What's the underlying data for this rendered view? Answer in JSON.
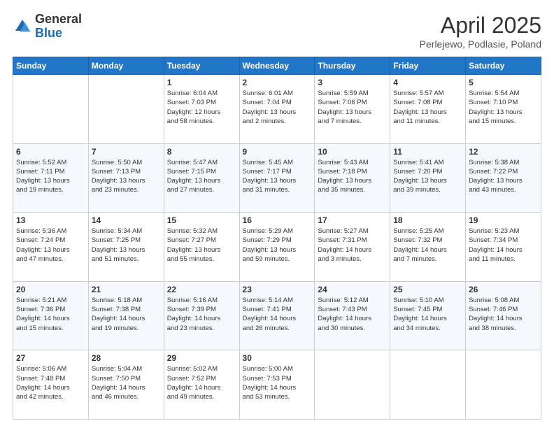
{
  "header": {
    "logo_general": "General",
    "logo_blue": "Blue",
    "month_title": "April 2025",
    "subtitle": "Perlejewo, Podlasie, Poland"
  },
  "days_of_week": [
    "Sunday",
    "Monday",
    "Tuesday",
    "Wednesday",
    "Thursday",
    "Friday",
    "Saturday"
  ],
  "weeks": [
    [
      {
        "day": "",
        "info": ""
      },
      {
        "day": "",
        "info": ""
      },
      {
        "day": "1",
        "info": "Sunrise: 6:04 AM\nSunset: 7:03 PM\nDaylight: 12 hours\nand 58 minutes."
      },
      {
        "day": "2",
        "info": "Sunrise: 6:01 AM\nSunset: 7:04 PM\nDaylight: 13 hours\nand 2 minutes."
      },
      {
        "day": "3",
        "info": "Sunrise: 5:59 AM\nSunset: 7:06 PM\nDaylight: 13 hours\nand 7 minutes."
      },
      {
        "day": "4",
        "info": "Sunrise: 5:57 AM\nSunset: 7:08 PM\nDaylight: 13 hours\nand 11 minutes."
      },
      {
        "day": "5",
        "info": "Sunrise: 5:54 AM\nSunset: 7:10 PM\nDaylight: 13 hours\nand 15 minutes."
      }
    ],
    [
      {
        "day": "6",
        "info": "Sunrise: 5:52 AM\nSunset: 7:11 PM\nDaylight: 13 hours\nand 19 minutes."
      },
      {
        "day": "7",
        "info": "Sunrise: 5:50 AM\nSunset: 7:13 PM\nDaylight: 13 hours\nand 23 minutes."
      },
      {
        "day": "8",
        "info": "Sunrise: 5:47 AM\nSunset: 7:15 PM\nDaylight: 13 hours\nand 27 minutes."
      },
      {
        "day": "9",
        "info": "Sunrise: 5:45 AM\nSunset: 7:17 PM\nDaylight: 13 hours\nand 31 minutes."
      },
      {
        "day": "10",
        "info": "Sunrise: 5:43 AM\nSunset: 7:18 PM\nDaylight: 13 hours\nand 35 minutes."
      },
      {
        "day": "11",
        "info": "Sunrise: 5:41 AM\nSunset: 7:20 PM\nDaylight: 13 hours\nand 39 minutes."
      },
      {
        "day": "12",
        "info": "Sunrise: 5:38 AM\nSunset: 7:22 PM\nDaylight: 13 hours\nand 43 minutes."
      }
    ],
    [
      {
        "day": "13",
        "info": "Sunrise: 5:36 AM\nSunset: 7:24 PM\nDaylight: 13 hours\nand 47 minutes."
      },
      {
        "day": "14",
        "info": "Sunrise: 5:34 AM\nSunset: 7:25 PM\nDaylight: 13 hours\nand 51 minutes."
      },
      {
        "day": "15",
        "info": "Sunrise: 5:32 AM\nSunset: 7:27 PM\nDaylight: 13 hours\nand 55 minutes."
      },
      {
        "day": "16",
        "info": "Sunrise: 5:29 AM\nSunset: 7:29 PM\nDaylight: 13 hours\nand 59 minutes."
      },
      {
        "day": "17",
        "info": "Sunrise: 5:27 AM\nSunset: 7:31 PM\nDaylight: 14 hours\nand 3 minutes."
      },
      {
        "day": "18",
        "info": "Sunrise: 5:25 AM\nSunset: 7:32 PM\nDaylight: 14 hours\nand 7 minutes."
      },
      {
        "day": "19",
        "info": "Sunrise: 5:23 AM\nSunset: 7:34 PM\nDaylight: 14 hours\nand 11 minutes."
      }
    ],
    [
      {
        "day": "20",
        "info": "Sunrise: 5:21 AM\nSunset: 7:36 PM\nDaylight: 14 hours\nand 15 minutes."
      },
      {
        "day": "21",
        "info": "Sunrise: 5:18 AM\nSunset: 7:38 PM\nDaylight: 14 hours\nand 19 minutes."
      },
      {
        "day": "22",
        "info": "Sunrise: 5:16 AM\nSunset: 7:39 PM\nDaylight: 14 hours\nand 23 minutes."
      },
      {
        "day": "23",
        "info": "Sunrise: 5:14 AM\nSunset: 7:41 PM\nDaylight: 14 hours\nand 26 minutes."
      },
      {
        "day": "24",
        "info": "Sunrise: 5:12 AM\nSunset: 7:43 PM\nDaylight: 14 hours\nand 30 minutes."
      },
      {
        "day": "25",
        "info": "Sunrise: 5:10 AM\nSunset: 7:45 PM\nDaylight: 14 hours\nand 34 minutes."
      },
      {
        "day": "26",
        "info": "Sunrise: 5:08 AM\nSunset: 7:46 PM\nDaylight: 14 hours\nand 38 minutes."
      }
    ],
    [
      {
        "day": "27",
        "info": "Sunrise: 5:06 AM\nSunset: 7:48 PM\nDaylight: 14 hours\nand 42 minutes."
      },
      {
        "day": "28",
        "info": "Sunrise: 5:04 AM\nSunset: 7:50 PM\nDaylight: 14 hours\nand 46 minutes."
      },
      {
        "day": "29",
        "info": "Sunrise: 5:02 AM\nSunset: 7:52 PM\nDaylight: 14 hours\nand 49 minutes."
      },
      {
        "day": "30",
        "info": "Sunrise: 5:00 AM\nSunset: 7:53 PM\nDaylight: 14 hours\nand 53 minutes."
      },
      {
        "day": "",
        "info": ""
      },
      {
        "day": "",
        "info": ""
      },
      {
        "day": "",
        "info": ""
      }
    ]
  ]
}
